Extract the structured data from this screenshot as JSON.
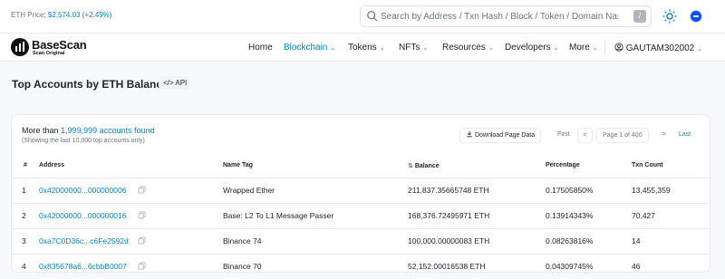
{
  "topbar": {
    "price_label": "ETH Price:",
    "price_value": "$2,574.03",
    "price_change": "(+2.49%)",
    "search_placeholder": "Search by Address / Txn Hash / Block / Token / Domain Nam",
    "search_shortcut": "/"
  },
  "brand": {
    "name": "BaseScan",
    "tagline": "Scan Original"
  },
  "nav": {
    "items": [
      {
        "label": "Home"
      },
      {
        "label": "Blockchain"
      },
      {
        "label": "Tokens"
      },
      {
        "label": "NFTs"
      },
      {
        "label": "Resources"
      },
      {
        "label": "Developers"
      },
      {
        "label": "More"
      }
    ],
    "user": "GAUTAM302002"
  },
  "page": {
    "title": "Top Accounts by ETH Balance",
    "api_label": "API"
  },
  "summary": {
    "prefix": "More than",
    "count": "1,999,999 accounts found",
    "note": "(Showing the last 10,000 top accounts only)"
  },
  "toolbar": {
    "download": "Download Page Data",
    "first": "First",
    "prev": "<",
    "page_info": "Page 1 of 400",
    "next": ">",
    "last": "Last"
  },
  "table": {
    "headers": [
      "#",
      "Address",
      "Name Tag",
      "Balance",
      "Percentage",
      "Txn Count"
    ],
    "rows": [
      {
        "rank": "1",
        "address": "0x42000000...000000006",
        "tag": "Wrapped Ether",
        "balance": "211,837.35665748 ETH",
        "percentage": "0.17505850%",
        "txns": "13,455,359"
      },
      {
        "rank": "2",
        "address": "0x42000000...000000016",
        "tag": "Base: L2 To L1 Message Passer",
        "balance": "168,376.72495971 ETH",
        "percentage": "0.13914343%",
        "txns": "70,427"
      },
      {
        "rank": "3",
        "address": "0xa7C0D36c...c6Fe2592d",
        "tag": "Binance 74",
        "balance": "100,000.00000083 ETH",
        "percentage": "0.08263816%",
        "txns": "14"
      },
      {
        "rank": "4",
        "address": "0x835678a6...6cbbB0007",
        "tag": "Binance 70",
        "balance": "52,152.00016538 ETH",
        "percentage": "0.04309745%",
        "txns": "46"
      }
    ]
  },
  "colors": {
    "accent": "#0784c3",
    "muted": "#6c757d",
    "base_blue": "#0052ff"
  }
}
